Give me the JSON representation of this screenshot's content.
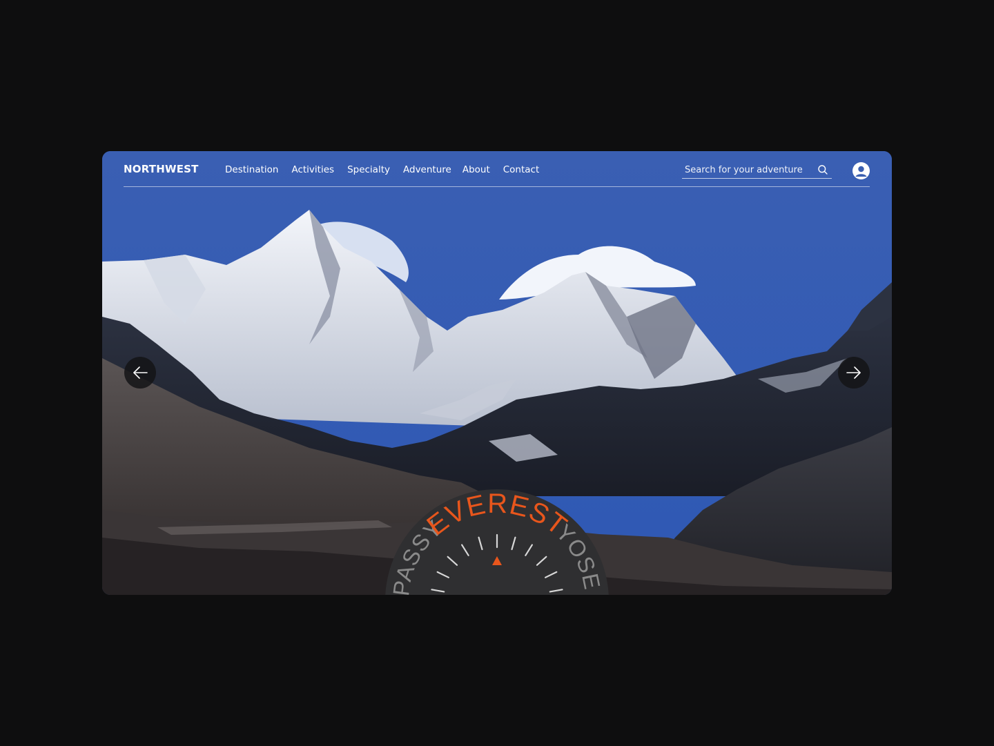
{
  "brand": {
    "logo_text": "NORTHWEST"
  },
  "nav": {
    "items": [
      {
        "label": "Destination"
      },
      {
        "label": "Activities"
      },
      {
        "label": "Specialty"
      },
      {
        "label": "Adventure"
      },
      {
        "label": "About"
      },
      {
        "label": "Contact"
      }
    ]
  },
  "search": {
    "placeholder": "Search for your adventure"
  },
  "hero": {
    "icons": {
      "prev": "arrow-left-icon",
      "next": "arrow-right-icon",
      "search": "search-icon",
      "user": "user-avatar-icon"
    }
  },
  "dial": {
    "left_label": "PASSY",
    "active_label": "EVEREST",
    "right_label": "YOSE",
    "active_color": "#e8561c",
    "inactive_color": "#8a8a8a",
    "pointer_color": "#e8561c"
  },
  "colors": {
    "sky": "#3b5fb0",
    "background": "#0e0e0f",
    "dial_bg": "#2f2f31"
  }
}
